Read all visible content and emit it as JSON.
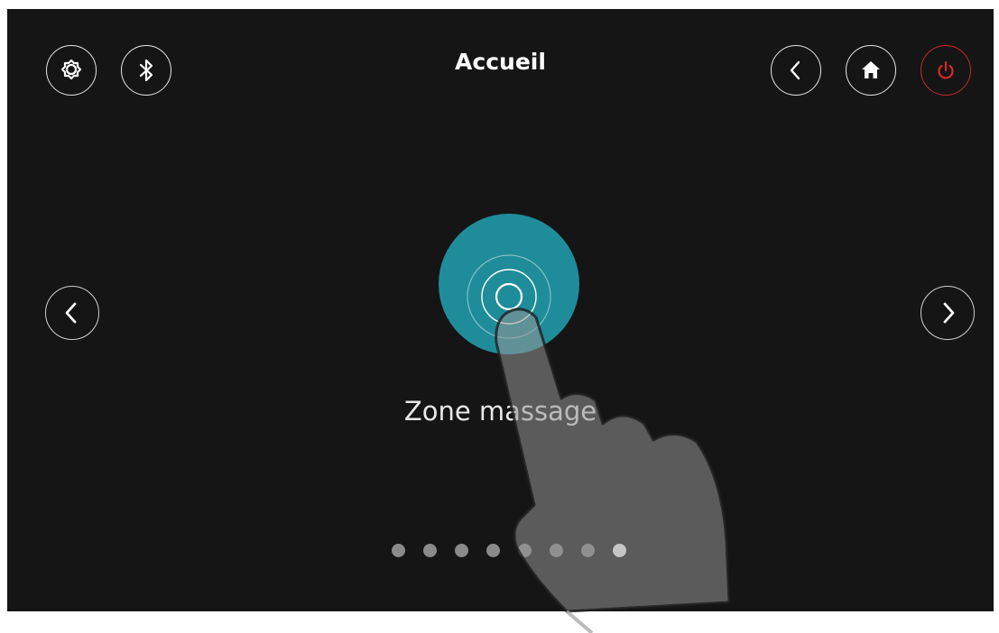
{
  "header": {
    "title": "Accueil"
  },
  "main": {
    "feature_label": "Zone massage"
  },
  "pagination": {
    "total": 8,
    "active_index": 7
  },
  "colors": {
    "background": "#151515",
    "accent_teal": "#1f8c99",
    "power_red": "#c8262c",
    "icon_stroke": "#ffffff"
  },
  "icons": {
    "settings": "gear-icon",
    "bluetooth": "bluetooth-icon",
    "back": "chevron-left-icon",
    "home": "home-icon",
    "power": "power-icon",
    "previous": "chevron-left-icon",
    "next": "chevron-right-icon",
    "feature": "massage-zone-icon"
  }
}
